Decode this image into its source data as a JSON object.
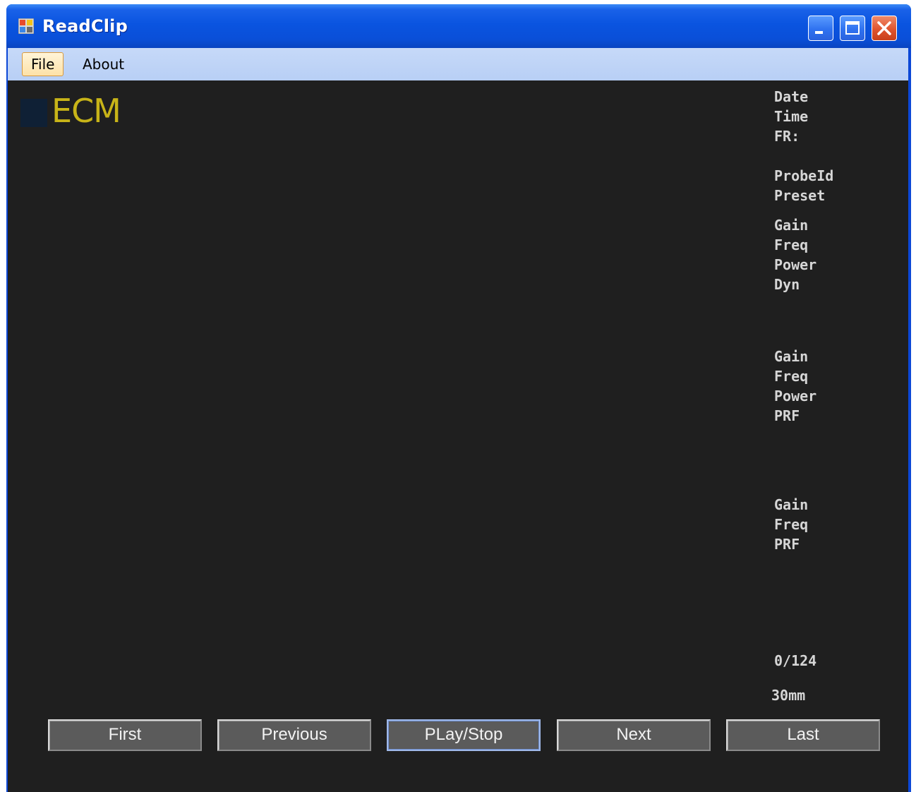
{
  "window": {
    "title": "ReadClip",
    "controls": [
      "minimize-icon",
      "maximize-icon",
      "close-icon"
    ]
  },
  "menu": {
    "items": [
      {
        "label": "File",
        "active": true
      },
      {
        "label": "About",
        "active": false
      }
    ]
  },
  "logo": {
    "text": "ECM"
  },
  "info": {
    "header": [
      "Date",
      "Time",
      "FR:"
    ],
    "probe": [
      "ProbeId",
      "Preset"
    ],
    "bmode": [
      "Gain",
      "Freq",
      "Power",
      "Dyn"
    ],
    "color": [
      "Gain",
      "Freq",
      "Power",
      "PRF"
    ],
    "doppler": [
      "Gain",
      "Freq",
      "PRF"
    ],
    "frame_counter": "0/124",
    "depth": "30mm"
  },
  "controls": {
    "first": "First",
    "previous": "Previous",
    "play_stop": "PLay/Stop",
    "next": "Next",
    "last": "Last"
  },
  "colors": {
    "titlebar": "#0a54e0",
    "client_bg": "#1f1f1f",
    "logo": "#c8b418",
    "text": "#d6d6d6",
    "button": "#5b5b5b"
  }
}
